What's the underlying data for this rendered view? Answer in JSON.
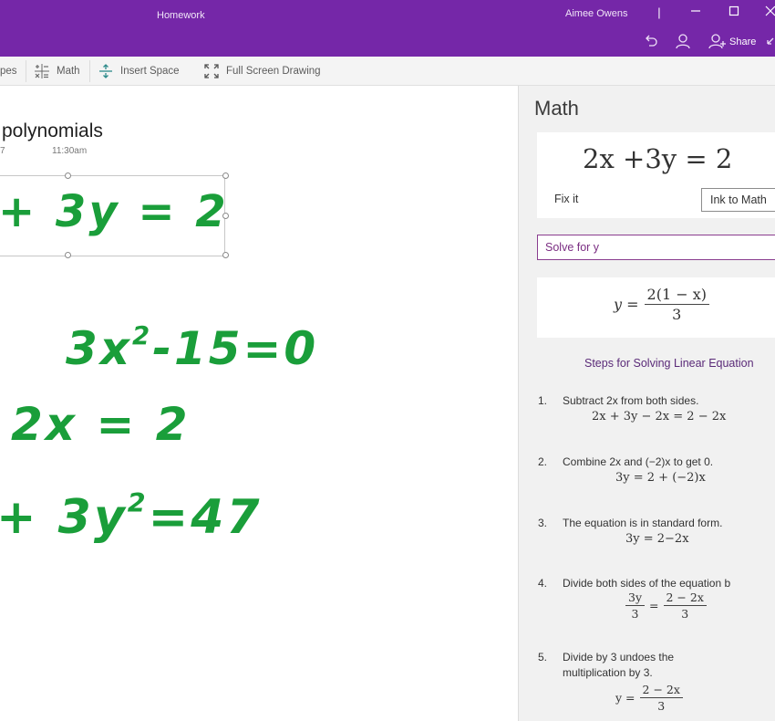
{
  "window": {
    "app_title": "Homework",
    "user_name": "Aimee Owens",
    "share_label": "Share"
  },
  "toolbar": {
    "items": [
      {
        "label": "pes",
        "icon": "shapes-icon"
      },
      {
        "label": "Math",
        "icon": "math-icon"
      },
      {
        "label": "Insert Space",
        "icon": "insert-space-icon"
      },
      {
        "label": "Full Screen Drawing",
        "icon": "full-screen-icon"
      }
    ]
  },
  "page": {
    "title": "polynomials",
    "date": "7",
    "time": "11:30am",
    "ink_lines": [
      "+ 3y = 2",
      "3x² - 15 = 0",
      "2x = 2",
      "+ 3y² = 47"
    ]
  },
  "math_pane": {
    "title": "Math",
    "equation": "2x +3y = 2",
    "fix_it": "Fix it",
    "ink_to_math": "Ink to Math",
    "solve_option": "Solve for y",
    "result": {
      "lhs": "y =",
      "num": "2(1 − x)",
      "den": "3"
    },
    "steps_title": "Steps for Solving Linear Equation",
    "steps": [
      {
        "num": "1.",
        "text": "Subtract 2x from both sides.",
        "eq": "2x + 3y − 2x = 2 − 2x"
      },
      {
        "num": "2.",
        "text": "Combine 2x and (−2)x to get 0.",
        "eq": "3y = 2 + (−2)x"
      },
      {
        "num": "3.",
        "text": "The equation is in standard form.",
        "eq": "3y = 2−2x"
      },
      {
        "num": "4.",
        "text": "Divide both sides of the equation b",
        "eq_lhs_num": "3y",
        "eq_lhs_den": "3",
        "eq_rhs_num": "2 − 2x",
        "eq_rhs_den": "3"
      },
      {
        "num": "5.",
        "text_line1": "Divide by 3 undoes the",
        "text_line2": "multiplication by 3.",
        "eq_lhs": "y =",
        "eq_num": "2 − 2x",
        "eq_den": "3"
      }
    ]
  },
  "colors": {
    "title_bar": "#7527a8",
    "ink": "#1a9e3a",
    "accent": "#7a2d82"
  }
}
